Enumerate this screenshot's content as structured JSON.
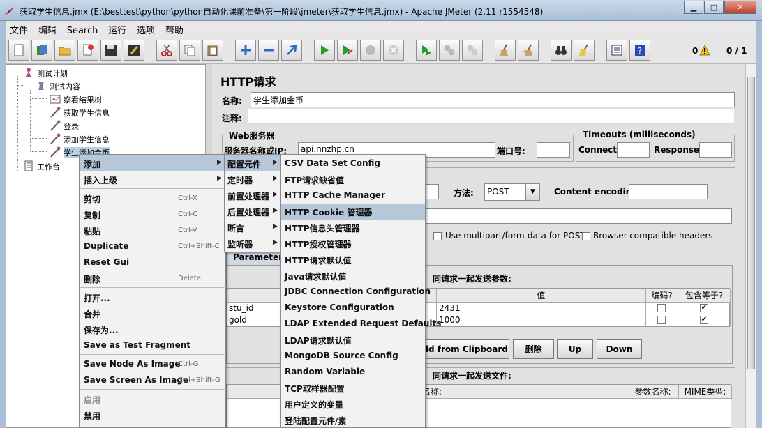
{
  "window": {
    "title": "获取学生信息.jmx (E:\\besttest\\python\\python自动化课前准备\\第一阶段\\jmeter\\获取学生信息.jmx) - Apache JMeter (2.11 r1554548)",
    "min_glyph": "▁",
    "max_glyph": "□",
    "close_glyph": "✕"
  },
  "menubar": [
    "文件",
    "编辑",
    "Search",
    "运行",
    "选项",
    "帮助"
  ],
  "toolbar": {
    "icons": [
      "new-icon",
      "templates-icon",
      "open-icon",
      "close-file-icon",
      "save-icon",
      "save-as-icon",
      "cut-icon",
      "copy-icon",
      "paste-icon",
      "expand-icon",
      "collapse-icon",
      "toggle-icon",
      "start-icon",
      "start-no-pause-icon",
      "stop-icon",
      "shutdown-icon",
      "remote-start-icon",
      "remote-stop-icon",
      "remote-shutdown-icon",
      "clear-icon",
      "clear-all-icon",
      "search-icon",
      "reset-search-icon",
      "function-helper-icon",
      "help-icon"
    ],
    "warnings": "0",
    "threads": "0 / 1"
  },
  "tree": {
    "items": [
      {
        "label": "测试计划",
        "icon": "test-plan-icon"
      },
      {
        "label": "测试内容",
        "icon": "thread-group-icon"
      },
      {
        "label": "察看结果树",
        "icon": "listener-icon"
      },
      {
        "label": "获取学生信息",
        "icon": "sampler-icon"
      },
      {
        "label": "登录",
        "icon": "sampler-icon"
      },
      {
        "label": "添加学生信息",
        "icon": "sampler-icon"
      },
      {
        "label": "学生添加金币",
        "icon": "sampler-icon"
      },
      {
        "label": "工作台",
        "icon": "workbench-icon"
      }
    ]
  },
  "panel": {
    "heading": "HTTP请求",
    "name_label": "名称:",
    "name_value": "学生添加金币",
    "comment_label": "注释:",
    "web_server_legend": "Web服务器",
    "server_label": "服务器名称或IP:",
    "server_value": "api.nnzhp.cn",
    "port_label": "端口号:",
    "port_value": "",
    "timeouts_legend": "Timeouts (milliseconds)",
    "connect_label": "Connect:",
    "response_label": "Response:",
    "method_label": "方法:",
    "method_value": "POST",
    "encoding_label": "Content encoding:",
    "multipart_label": "Use multipart/form-data for POST",
    "browser_label": "Browser-compatible headers",
    "params_tab": "Parameters",
    "send_params_title": "同请求一起发送参数:",
    "col_value": "值",
    "col_encode": "编码?",
    "col_include": "包含等于?",
    "rows": [
      {
        "name": "stu_id",
        "value": "2431"
      },
      {
        "name": "gold",
        "value": "1000"
      }
    ],
    "btn_clipboard": "Add from Clipboard",
    "btn_delete": "删除",
    "btn_up": "Up",
    "btn_down": "Down",
    "send_files_title": "同请求一起发送文件:",
    "col_file_name": "名称:",
    "col_param_name": "参数名称:",
    "col_mime": "MIME类型:",
    "check_glyph": "✔"
  },
  "context_menu": {
    "items": [
      {
        "label": "添加",
        "arrow": "▶"
      },
      {
        "label": "插入上级",
        "arrow": "▶"
      },
      {
        "label": "剪切",
        "key": "Ctrl-X"
      },
      {
        "label": "复制",
        "key": "Ctrl-C"
      },
      {
        "label": "粘贴",
        "key": "Ctrl-V"
      },
      {
        "label": "Duplicate",
        "key": "Ctrl+Shift-C"
      },
      {
        "label": "Reset Gui"
      },
      {
        "label": "删除",
        "key": "Delete"
      },
      {
        "label": "打开..."
      },
      {
        "label": "合并"
      },
      {
        "label": "保存为..."
      },
      {
        "label": "Save as Test Fragment"
      },
      {
        "label": "Save Node As Image",
        "key": "Ctrl-G"
      },
      {
        "label": "Save Screen As Image",
        "key": "Ctrl+Shift-G"
      },
      {
        "label": "启用"
      },
      {
        "label": "禁用"
      }
    ]
  },
  "add_submenu": {
    "items": [
      {
        "label": "配置元件",
        "arrow": "▶"
      },
      {
        "label": "定时器",
        "arrow": "▶"
      },
      {
        "label": "前置处理器",
        "arrow": "▶"
      },
      {
        "label": "后置处理器",
        "arrow": "▶"
      },
      {
        "label": "断言",
        "arrow": "▶"
      },
      {
        "label": "监听器",
        "arrow": "▶"
      }
    ]
  },
  "config_submenu": {
    "items": [
      "CSV Data Set Config",
      "FTP请求缺省值",
      "HTTP Cache Manager",
      "HTTP Cookie 管理器",
      "HTTP信息头管理器",
      "HTTP授权管理器",
      "HTTP请求默认值",
      "Java请求默认值",
      "JDBC Connection Configuration",
      "Keystore Configuration",
      "LDAP Extended Request Defaults",
      "LDAP请求默认值",
      "MongoDB Source Config",
      "Random Variable",
      "TCP取样器配置",
      "用户定义的变量",
      "登陆配置元件/素"
    ]
  }
}
